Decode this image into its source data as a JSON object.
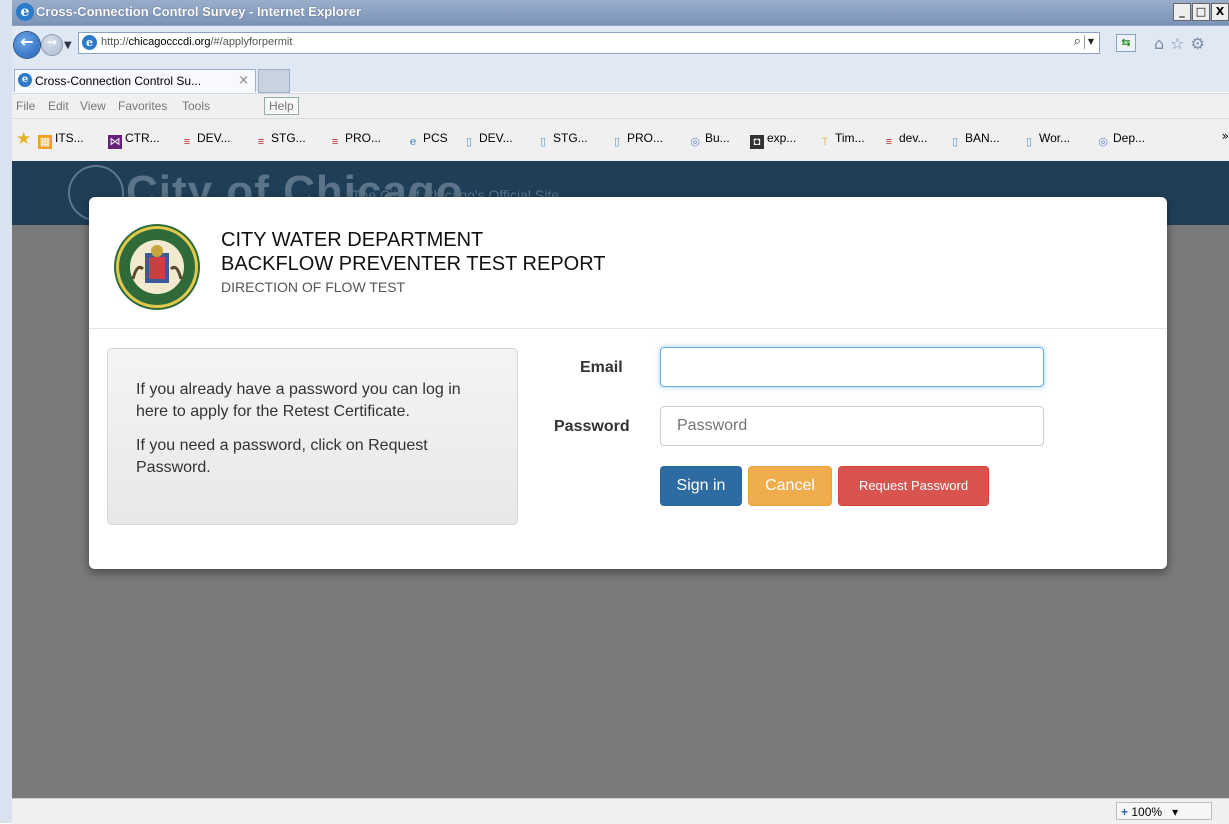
{
  "window": {
    "title": "Cross-Connection Control Survey - Internet Explorer",
    "controls": [
      "_",
      "□",
      "X"
    ]
  },
  "nav": {
    "url_prefix": "http://",
    "url_domain": "chicagocccdi.org",
    "url_path": "/#/applyforpermit",
    "search_glyph": "⌕"
  },
  "tab": {
    "label": "Cross-Connection Control Su...",
    "close": "×"
  },
  "menu": {
    "items": [
      "File",
      "Edit",
      "View",
      "Favorites",
      "Tools",
      "Help"
    ]
  },
  "favorites": {
    "items": [
      "ITS...",
      "CTR...",
      "DEV...",
      "STG...",
      "PRO...",
      "PCS",
      "DEV...",
      "STG...",
      "PRO...",
      "Bu...",
      "exp...",
      "Tim...",
      "dev...",
      "BAN...",
      "Wor...",
      "Dep..."
    ],
    "more": "»"
  },
  "site": {
    "name": "City of Chicago",
    "tagline": "The City of Chicago's Official Site"
  },
  "dialog": {
    "title_line1": "CITY WATER DEPARTMENT",
    "title_line2": "BACKFLOW PREVENTER TEST REPORT",
    "subtitle": "DIRECTION OF FLOW TEST",
    "info_para1": "If you already have a password you can log in here to apply for the Retest Certificate.",
    "info_para2": "If you need a password, click on Request Password.",
    "email_label": "Email",
    "email_value": "",
    "password_label": "Password",
    "password_placeholder": "Password",
    "signin_label": "Sign in",
    "cancel_label": "Cancel",
    "request_label": "Request Password"
  },
  "status": {
    "zoom": "100%",
    "zoom_dropdown": "▾"
  },
  "colors": {
    "header_bg": "#1f3f59",
    "overlay_bg": "#7a7a7a",
    "signin": "#2d6ca2",
    "cancel": "#f0ad4e",
    "request": "#d9534f"
  }
}
